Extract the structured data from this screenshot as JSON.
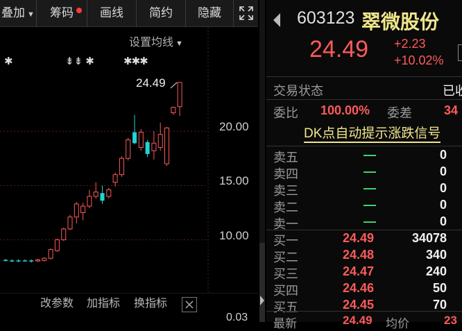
{
  "toolbar": {
    "overlay_label": "叠加",
    "chips_label": "筹码",
    "draw_label": "画线",
    "simple_label": "简约",
    "hide_label": "隐藏"
  },
  "chart": {
    "ma_settings_label": "设置均线",
    "markers": [
      "✱",
      "⇟⇟ ✱",
      "✱✱✱"
    ],
    "last_price_callout": "24.49",
    "price_labels": [
      "20.00",
      "15.00",
      "10.00",
      "0.03"
    ]
  },
  "chart_data": {
    "type": "candlestick",
    "y_ticks": [
      20.0,
      15.0,
      10.0
    ],
    "ylim": [
      5.5,
      25.5
    ],
    "candles": [
      {
        "o": 8.1,
        "c": 8.15,
        "h": 8.25,
        "l": 8.0,
        "up": false
      },
      {
        "o": 8.1,
        "c": 8.05,
        "h": 8.2,
        "l": 7.95,
        "up": false
      },
      {
        "o": 8.05,
        "c": 8.1,
        "h": 8.2,
        "l": 7.95,
        "up": false
      },
      {
        "o": 8.1,
        "c": 8.05,
        "h": 8.2,
        "l": 8.0,
        "up": false
      },
      {
        "o": 8.0,
        "c": 8.1,
        "h": 8.2,
        "l": 7.9,
        "up": false
      },
      {
        "o": 8.05,
        "c": 8.15,
        "h": 8.25,
        "l": 7.95,
        "up": true
      },
      {
        "o": 8.1,
        "c": 8.3,
        "h": 8.4,
        "l": 8.0,
        "up": true
      },
      {
        "o": 8.3,
        "c": 9.1,
        "h": 9.2,
        "l": 8.2,
        "up": true
      },
      {
        "o": 9.0,
        "c": 10.0,
        "h": 10.1,
        "l": 8.9,
        "up": true
      },
      {
        "o": 10.0,
        "c": 11.0,
        "h": 11.1,
        "l": 9.9,
        "up": true
      },
      {
        "o": 11.0,
        "c": 12.1,
        "h": 12.3,
        "l": 10.9,
        "up": true
      },
      {
        "o": 12.1,
        "c": 13.3,
        "h": 13.5,
        "l": 11.5,
        "up": true
      },
      {
        "o": 12.5,
        "c": 13.1,
        "h": 13.4,
        "l": 11.8,
        "up": true
      },
      {
        "o": 13.1,
        "c": 14.0,
        "h": 14.6,
        "l": 12.9,
        "up": true
      },
      {
        "o": 14.0,
        "c": 14.4,
        "h": 15.3,
        "l": 13.8,
        "up": true
      },
      {
        "o": 14.3,
        "c": 13.6,
        "h": 15.0,
        "l": 13.3,
        "up": false
      },
      {
        "o": 14.0,
        "c": 14.6,
        "h": 14.8,
        "l": 13.8,
        "up": true
      },
      {
        "o": 15.3,
        "c": 16.0,
        "h": 16.2,
        "l": 14.9,
        "up": true
      },
      {
        "o": 16.0,
        "c": 17.5,
        "h": 17.7,
        "l": 15.8,
        "up": true
      },
      {
        "o": 17.5,
        "c": 19.2,
        "h": 19.4,
        "l": 17.3,
        "up": true
      },
      {
        "o": 19.9,
        "c": 18.9,
        "h": 21.5,
        "l": 18.8,
        "up": false
      },
      {
        "o": 18.5,
        "c": 19.9,
        "h": 20.2,
        "l": 18.2,
        "up": true
      },
      {
        "o": 19.0,
        "c": 17.9,
        "h": 19.2,
        "l": 17.6,
        "up": false
      },
      {
        "o": 18.2,
        "c": 18.9,
        "h": 20.0,
        "l": 17.4,
        "up": true
      },
      {
        "o": 18.5,
        "c": 19.7,
        "h": 20.8,
        "l": 18.2,
        "up": true
      },
      {
        "o": 17.0,
        "c": 20.3,
        "h": 20.4,
        "l": 16.8,
        "up": true
      },
      {
        "o": 21.7,
        "c": 22.2,
        "h": 22.26,
        "l": 21.5,
        "up": true
      },
      {
        "o": 22.26,
        "c": 24.49,
        "h": 24.49,
        "l": 21.4,
        "up": true
      }
    ]
  },
  "bottom_bar": {
    "params_label": "改参数",
    "add_indicator_label": "加指标",
    "change_indicator_label": "换指标"
  },
  "stock": {
    "code": "603123",
    "name": "翠微股份",
    "price": "24.49",
    "change": "+2.23",
    "change_pct": "+10.02%"
  },
  "status": {
    "label": "交易状态",
    "value": "已收"
  },
  "ratio": {
    "label": "委比",
    "value": "100.00%",
    "diff_label": "委差",
    "diff_value": "34"
  },
  "signal_link": "DK点自动提示涨跌信号",
  "sell_orders": [
    {
      "label": "卖五",
      "price": "—",
      "volume": "0"
    },
    {
      "label": "卖四",
      "price": "—",
      "volume": "0"
    },
    {
      "label": "卖三",
      "price": "—",
      "volume": "0"
    },
    {
      "label": "卖二",
      "price": "—",
      "volume": "0"
    },
    {
      "label": "卖一",
      "price": "—",
      "volume": "0"
    }
  ],
  "buy_orders": [
    {
      "label": "买一",
      "price": "24.49",
      "volume": "34078"
    },
    {
      "label": "买二",
      "price": "24.48",
      "volume": "340"
    },
    {
      "label": "买三",
      "price": "24.47",
      "volume": "240"
    },
    {
      "label": "买四",
      "price": "24.46",
      "volume": "50"
    },
    {
      "label": "买五",
      "price": "24.45",
      "volume": "70"
    }
  ],
  "footer": {
    "latest_label": "最新",
    "latest_value": "24.49",
    "avg_label": "均价",
    "avg_value": "23"
  },
  "colors": {
    "up": "#ff5a5a",
    "down": "#22d3d3",
    "accent_yellow": "#f0e68c"
  }
}
